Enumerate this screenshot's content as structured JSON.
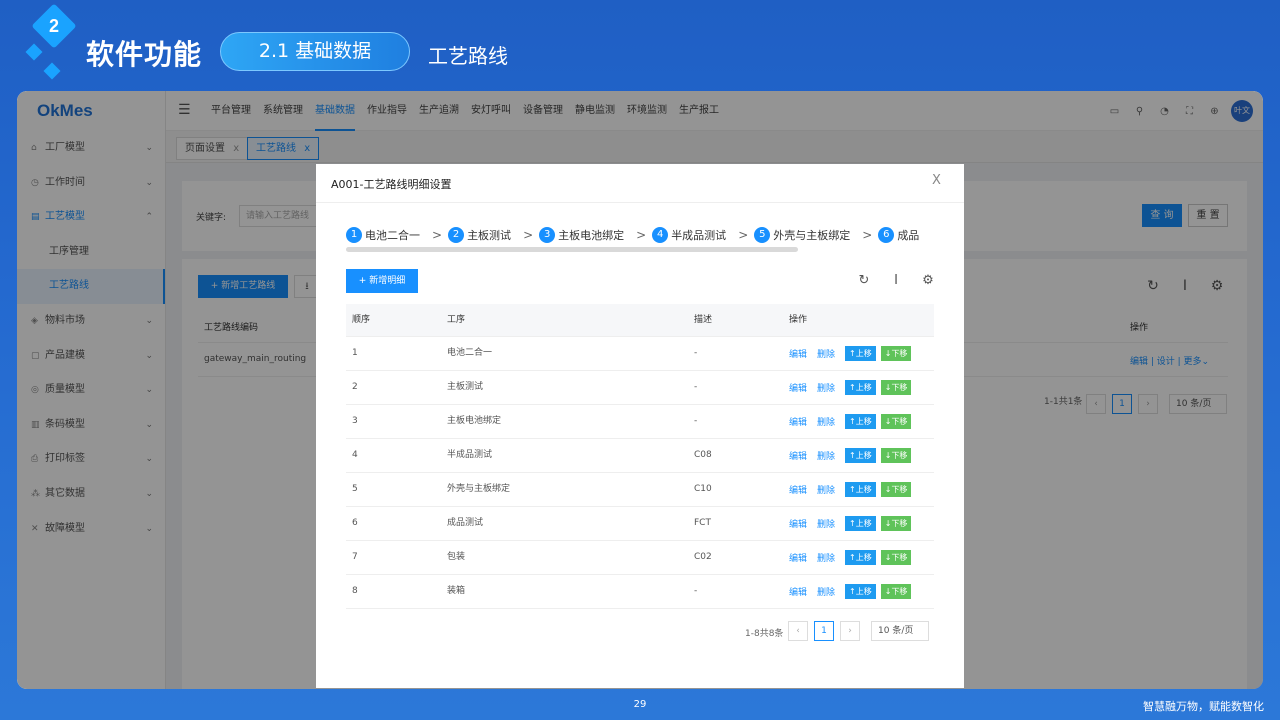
{
  "slide": {
    "section_number": "2",
    "title": "软件功能",
    "section_pill": "2.1 基础数据",
    "subtitle": "工艺路线",
    "page_number": "29",
    "slogan": "智慧融万物，赋能数智化"
  },
  "app": {
    "logo": "OkMes",
    "top_nav": [
      "平台管理",
      "系统管理",
      "基础数据",
      "作业指导",
      "生产追溯",
      "安灯呼叫",
      "设备管理",
      "静电监测",
      "环境监测",
      "生产报工"
    ],
    "active_nav": "基础数据",
    "top_icons": [
      "monitor-icon",
      "search-icon",
      "bell-icon",
      "fullscreen-icon",
      "globe-icon"
    ],
    "avatar_text": "叶文",
    "sidebar": [
      {
        "label": "工厂模型",
        "icon": "factory-icon",
        "chevron": "⌄"
      },
      {
        "label": "工作时间",
        "icon": "clock-icon",
        "chevron": "⌄"
      },
      {
        "label": "工艺模型",
        "icon": "process-icon",
        "chevron": "⌃",
        "active": true
      },
      {
        "label": "工序管理",
        "sub": true
      },
      {
        "label": "工艺路线",
        "sub": true,
        "selected": true
      },
      {
        "label": "物料市场",
        "icon": "material-icon",
        "chevron": "⌄"
      },
      {
        "label": "产品建模",
        "icon": "product-icon",
        "chevron": "⌄"
      },
      {
        "label": "质量模型",
        "icon": "quality-icon",
        "chevron": "⌄"
      },
      {
        "label": "条码模型",
        "icon": "barcode-icon",
        "chevron": "⌄"
      },
      {
        "label": "打印标签",
        "icon": "print-icon",
        "chevron": "⌄"
      },
      {
        "label": "其它数据",
        "icon": "data-icon",
        "chevron": "⌄"
      },
      {
        "label": "故障模型",
        "icon": "fault-icon",
        "chevron": "⌄"
      }
    ],
    "tabs": [
      {
        "label": "页面设置",
        "close": "x"
      },
      {
        "label": "工艺路线",
        "close": "x",
        "active": true
      }
    ],
    "search": {
      "label": "关键字:",
      "placeholder": "请输入工艺路线",
      "query_button": "查 询",
      "reset_button": "重 置"
    },
    "list": {
      "new_button": "+ 新增工艺路线",
      "col_code": "工艺路线编码",
      "col_ops": "操作",
      "row_code": "gateway_main_routing",
      "row_ops": "编辑 | 设计 | 更多⌄",
      "pager_text": "1-1共1条",
      "current_page": "1",
      "page_size": "10 条/页"
    }
  },
  "modal": {
    "title": "A001-工艺路线明细设置",
    "close": "X",
    "steps": [
      {
        "num": "1",
        "label": "电池二合一"
      },
      {
        "num": "2",
        "label": "主板测试"
      },
      {
        "num": "3",
        "label": "主板电池绑定"
      },
      {
        "num": "4",
        "label": "半成品测试"
      },
      {
        "num": "5",
        "label": "外壳与主板绑定"
      },
      {
        "num": "6",
        "label": "成品"
      }
    ],
    "add_button": "+ 新增明细",
    "columns": {
      "seq": "顺序",
      "proc": "工序",
      "desc": "描述",
      "ops": "操作"
    },
    "actions": {
      "edit": "编辑",
      "delete": "删除",
      "up": "↑上移",
      "down": "↓下移"
    },
    "rows": [
      {
        "seq": "1",
        "proc": "电池二合一",
        "desc": "-"
      },
      {
        "seq": "2",
        "proc": "主板测试",
        "desc": "-"
      },
      {
        "seq": "3",
        "proc": "主板电池绑定",
        "desc": "-"
      },
      {
        "seq": "4",
        "proc": "半成品测试",
        "desc": "C08"
      },
      {
        "seq": "5",
        "proc": "外壳与主板绑定",
        "desc": "C10"
      },
      {
        "seq": "6",
        "proc": "成品测试",
        "desc": "FCT"
      },
      {
        "seq": "7",
        "proc": "包装",
        "desc": "C02"
      },
      {
        "seq": "8",
        "proc": "装箱",
        "desc": "-"
      }
    ],
    "pager_text": "1-8共8条",
    "current_page": "1",
    "page_size": "10 条/页"
  },
  "colors": {
    "primary": "#1890ff",
    "up_chip": "#1e9bf0",
    "down_chip": "#5fc35a",
    "slide_bg": "#2469cf"
  }
}
